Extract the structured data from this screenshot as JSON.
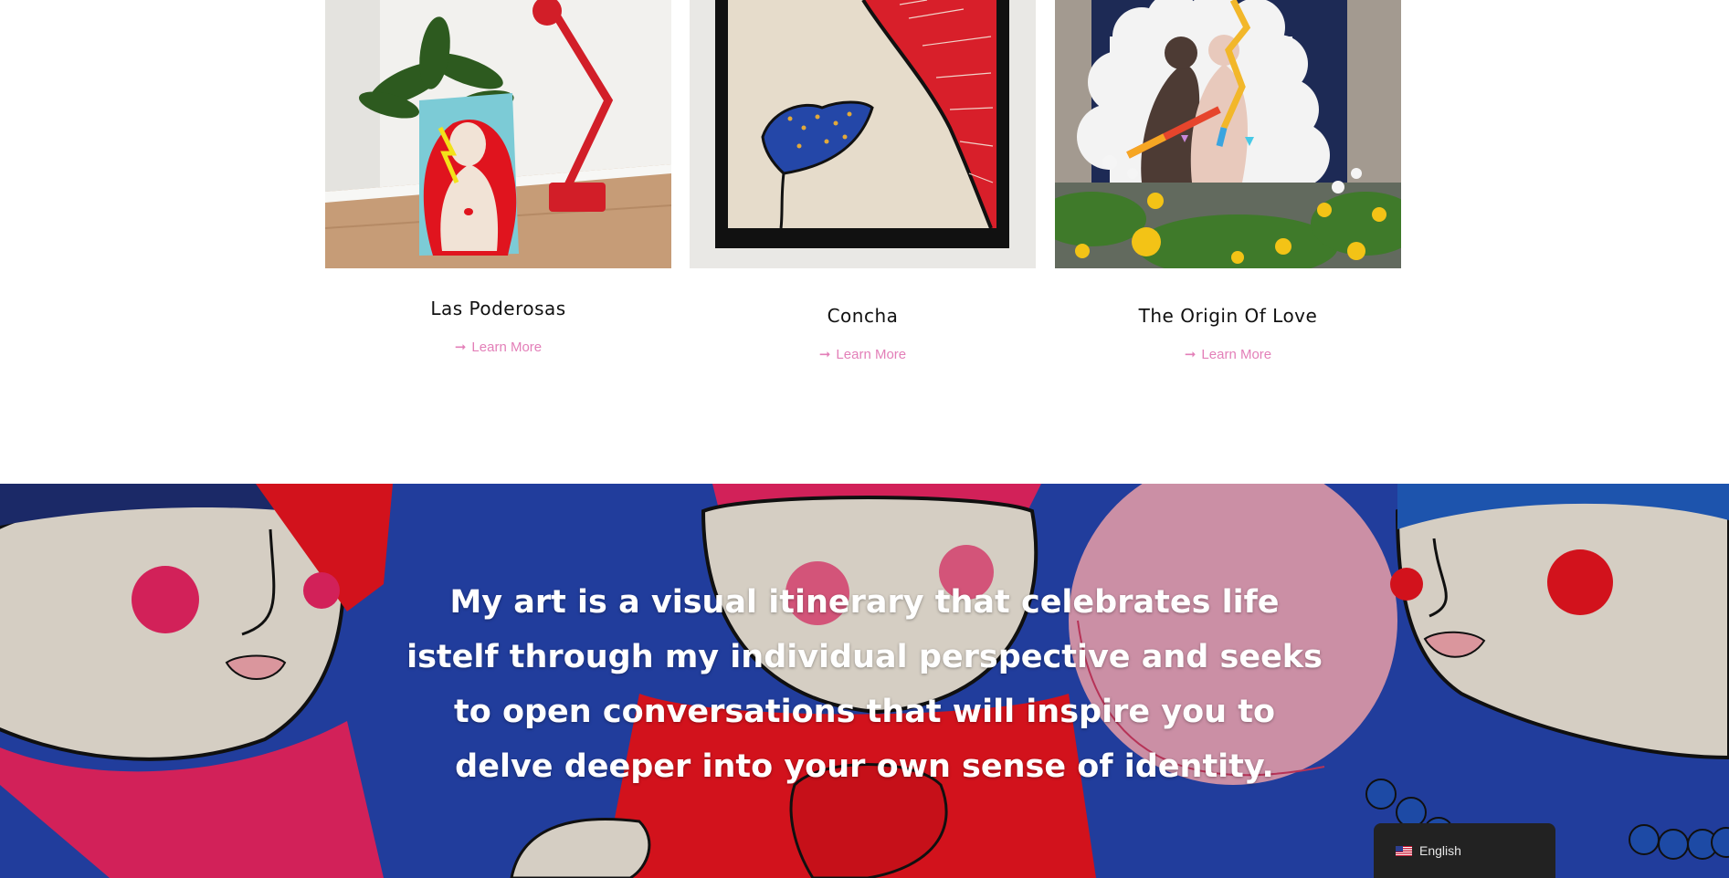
{
  "colors": {
    "accent": "#e37fb8",
    "title": "#111111",
    "banner_text": "#ffffff",
    "lang_bg": "#222222"
  },
  "artworks": [
    {
      "title": "Las Poderosas",
      "cta": "Learn More",
      "cta_icon": "arrow-right-icon"
    },
    {
      "title": "Concha",
      "cta": "Learn More",
      "cta_icon": "arrow-right-icon"
    },
    {
      "title": "The Origin Of Love",
      "cta": "Learn More",
      "cta_icon": "arrow-right-icon"
    }
  ],
  "banner": {
    "quote": "My art is a visual itinerary that celebrates life istelf through my individual perspective and seeks to open conversations that will inspire you to delve deeper into your own sense of identity."
  },
  "language_switcher": {
    "label": "English",
    "flag_icon": "us-flag-icon"
  }
}
